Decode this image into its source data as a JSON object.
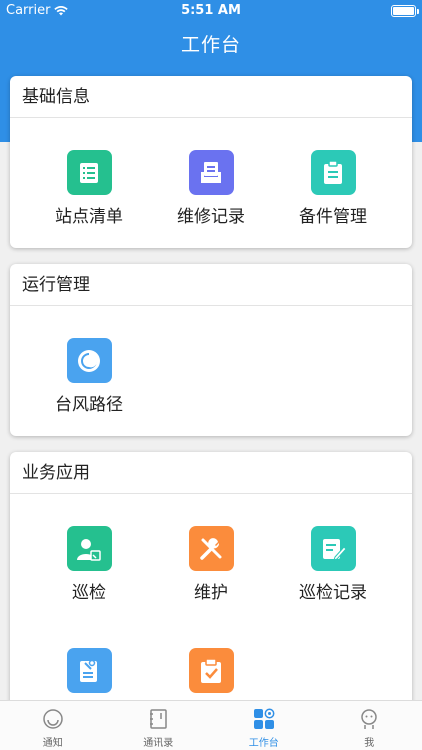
{
  "status_bar": {
    "carrier": "Carrier",
    "time": "5:51 AM"
  },
  "nav": {
    "title": "工作台"
  },
  "colors": {
    "primary": "#2f8fe6",
    "green": "#25c08f",
    "indigo": "#6a72f0",
    "teal": "#2cc9b7",
    "blue": "#4aa3ef",
    "orange": "#fb8c3c"
  },
  "sections": [
    {
      "title": "基础信息",
      "items": [
        {
          "label": "站点清单",
          "icon": "list-icon"
        },
        {
          "label": "维修记录",
          "icon": "repair-record-icon"
        },
        {
          "label": "备件管理",
          "icon": "clipboard-icon"
        }
      ]
    },
    {
      "title": "运行管理",
      "items": [
        {
          "label": "台风路径",
          "icon": "typhoon-icon"
        }
      ]
    },
    {
      "title": "业务应用",
      "items": [
        {
          "label": "巡检",
          "icon": "inspector-icon"
        },
        {
          "label": "维护",
          "icon": "tools-icon"
        },
        {
          "label": "巡检记录",
          "icon": "edit-record-icon"
        },
        {
          "label": "",
          "icon": "maintenance-doc-icon"
        },
        {
          "label": "",
          "icon": "checklist-icon"
        }
      ]
    }
  ],
  "tabbar": [
    {
      "label": "通知",
      "icon": "notification-face-icon",
      "active": false
    },
    {
      "label": "通讯录",
      "icon": "contacts-book-icon",
      "active": false
    },
    {
      "label": "工作台",
      "icon": "workbench-grid-icon",
      "active": true
    },
    {
      "label": "我",
      "icon": "profile-icon",
      "active": false
    }
  ]
}
